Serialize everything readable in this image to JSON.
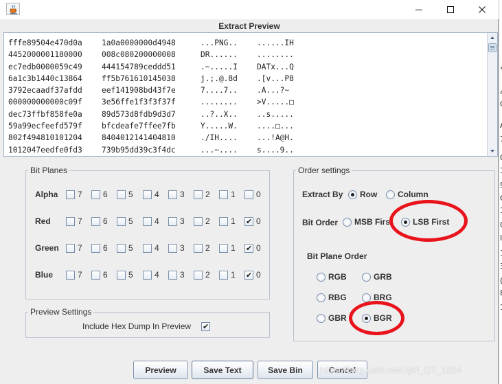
{
  "dialog": {
    "title": "Extract Preview"
  },
  "preview": {
    "lines": [
      {
        "hex1": "fffe89504e470d0a",
        "hex2": "1a0a0000000d4948",
        "ascii1": "...PNG..",
        "ascii2": "......IH"
      },
      {
        "hex1": "4452000001180000",
        "hex2": "008c080200000008",
        "ascii1": "DR......",
        "ascii2": "........"
      },
      {
        "hex1": "ec7edb0000059c49",
        "hex2": "444154789ceddd51",
        "ascii1": ".~.....I",
        "ascii2": "DATx...Q"
      },
      {
        "hex1": "6a1c3b1440c13864",
        "hex2": "ff5b761610145038",
        "ascii1": "j.;.@.8d",
        "ascii2": ".[v...P8"
      },
      {
        "hex1": "3792ecaadf37afdd",
        "hex2": "eef141908bd43f7e",
        "ascii1": "7....7..",
        "ascii2": ".A...?~"
      },
      {
        "hex1": "000000000000c09f",
        "hex2": "3e56ffe1f3f3f37f",
        "ascii1": "........",
        "ascii2": ">V.....□"
      },
      {
        "hex1": "dec73ffbf858fe0a",
        "hex2": "89d573d8fdb9d3d7",
        "ascii1": "..?..X..",
        "ascii2": "..s....."
      },
      {
        "hex1": "59a99ecfeefd579f",
        "hex2": "bfcdeafe7ffee7fb",
        "ascii1": "Y.....W.",
        "ascii2": "....□..."
      },
      {
        "hex1": "802f494810101204",
        "hex2": "8404012141404810",
        "ascii1": "./IH....",
        "ascii2": "...!A@H."
      },
      {
        "hex1": "1012047eedfe0fd3",
        "hex2": "739b95dd39c3f4dc",
        "ascii1": "...~....",
        "ascii2": "s....9.."
      }
    ]
  },
  "bit_planes": {
    "title": "Bit Planes",
    "bits": [
      "7",
      "6",
      "5",
      "4",
      "3",
      "2",
      "1",
      "0"
    ],
    "rows": [
      {
        "label": "Alpha",
        "checked": [
          false,
          false,
          false,
          false,
          false,
          false,
          false,
          false
        ]
      },
      {
        "label": "Red",
        "checked": [
          false,
          false,
          false,
          false,
          false,
          false,
          false,
          true
        ]
      },
      {
        "label": "Green",
        "checked": [
          false,
          false,
          false,
          false,
          false,
          false,
          false,
          true
        ]
      },
      {
        "label": "Blue",
        "checked": [
          false,
          false,
          false,
          false,
          false,
          false,
          false,
          true
        ]
      }
    ]
  },
  "preview_settings": {
    "title": "Preview Settings",
    "hex_dump_label": "Include Hex Dump In Preview",
    "hex_dump_checked": true
  },
  "order_settings": {
    "title": "Order settings",
    "extract_by_label": "Extract By",
    "extract_by_options": [
      "Row",
      "Column"
    ],
    "extract_by_selected": "Row",
    "bit_order_label": "Bit Order",
    "bit_order_options": [
      "MSB First",
      "LSB First"
    ],
    "bit_order_selected": "LSB First",
    "bit_plane_order_label": "Bit Plane Order",
    "bit_plane_order_options": [
      "RGB",
      "GRB",
      "RBG",
      "BRG",
      "GBR",
      "BGR"
    ],
    "bit_plane_order_selected": "BGR"
  },
  "buttons": {
    "preview": "Preview",
    "save_text": "Save Text",
    "save_bin": "Save Bin",
    "cancel": "Cancel"
  },
  "watermark": "https://blog.csdn.net/Jgirl_QT_1024",
  "background_window_chars": [
    "»",
    "4",
    "C",
    "A",
    "7",
    "0",
    "1",
    "9",
    "C",
    "1",
    "0",
    "I",
    "1",
    "3",
    "(",
    "8",
    "1"
  ],
  "colors": {
    "annotation_red": "#e8131b",
    "group_border": "#b8c3d0",
    "dialog_bg": "#eeeeee"
  },
  "icons": {
    "app": "java-cup-icon",
    "minimize": "minimize-icon",
    "maximize": "maximize-icon",
    "close": "close-icon"
  }
}
